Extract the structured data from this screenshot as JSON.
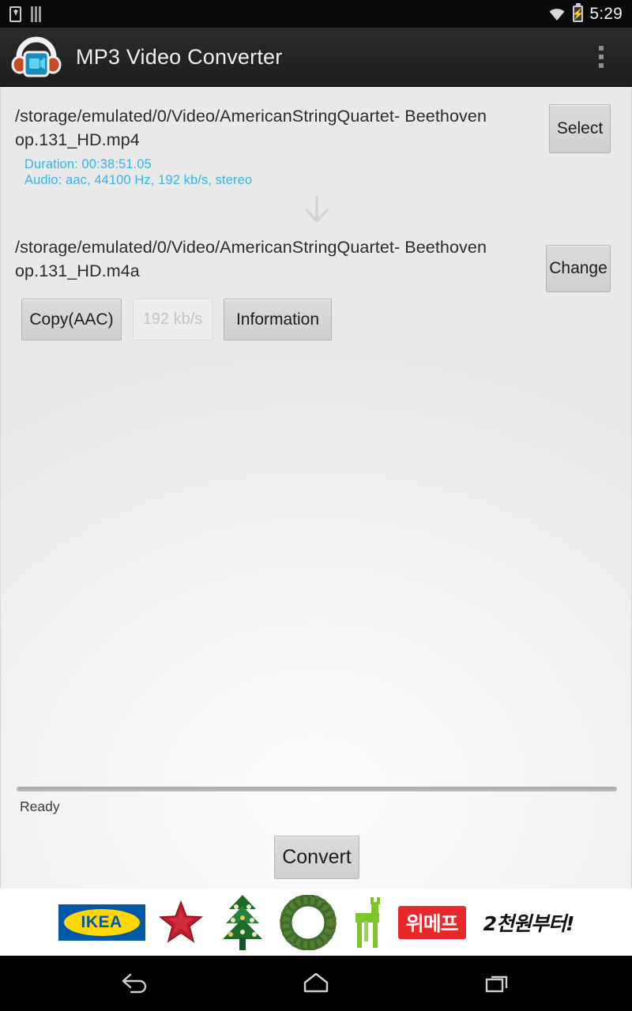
{
  "status_bar": {
    "time": "5:29",
    "icons": [
      "download-icon",
      "sd-card-icon",
      "wifi-icon",
      "battery-charging-icon"
    ]
  },
  "action_bar": {
    "app_icon": "headphones-video-icon",
    "title": "MP3 Video Converter",
    "overflow_icon": "more-vertical-icon"
  },
  "input_file": {
    "path": "/storage/emulated/0/Video/AmericanStringQuartet- Beethoven op.131_HD.mp4",
    "duration": "Duration: 00:38:51.05",
    "audio": "Audio: aac, 44100 Hz, 192 kb/s, stereo",
    "select_label": "Select",
    "info_color": "#35b4e2"
  },
  "arrow_icon": "arrow-down-icon",
  "output_file": {
    "path": "/storage/emulated/0/Video/AmericanStringQuartet- Beethoven op.131_HD.m4a",
    "change_label": "Change"
  },
  "options": {
    "codec_label": "Copy(AAC)",
    "bitrate_label": "192 kb/s",
    "bitrate_disabled": true,
    "information_label": "Information"
  },
  "progress": {
    "value": 0,
    "status_text": "Ready"
  },
  "convert": {
    "label": "Convert"
  },
  "ad": {
    "brand": "IKEA",
    "promo_badge": "위메프",
    "promo_text": "2천원부터!",
    "ornaments": [
      "star-ornament",
      "tree-ornament",
      "wreath-ornament",
      "reindeer-ornament"
    ]
  },
  "nav_bar": {
    "back": "back-icon",
    "home": "home-icon",
    "recents": "recents-icon"
  }
}
